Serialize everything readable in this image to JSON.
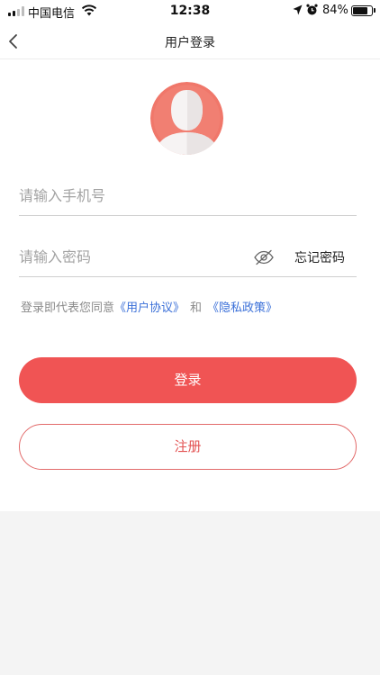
{
  "status_bar": {
    "carrier": "中国电信",
    "time": "12:38",
    "battery_percent": "84%",
    "battery_level": 0.84,
    "icons": [
      "signal-icon",
      "wifi-icon",
      "location-icon",
      "alarm-icon",
      "battery-icon"
    ]
  },
  "nav": {
    "back_icon": "chevron-left-icon",
    "title": "用户登录"
  },
  "avatar": {
    "icon": "default-avatar-icon",
    "color": "#f0776a"
  },
  "form": {
    "phone_placeholder": "请输入手机号",
    "phone_value": "",
    "password_placeholder": "请输入密码",
    "password_value": "",
    "visibility_icon": "eye-hidden-icon",
    "forgot_label": "忘记密码"
  },
  "agreement": {
    "prefix": "登录即代表您同意",
    "user_agreement": "《用户协议》",
    "and": "和",
    "privacy_policy": "《隐私政策》"
  },
  "buttons": {
    "login_label": "登录",
    "register_label": "注册"
  },
  "colors": {
    "primary": "#f05454",
    "link": "#3a6fd8",
    "placeholder": "#a3a3a3"
  }
}
